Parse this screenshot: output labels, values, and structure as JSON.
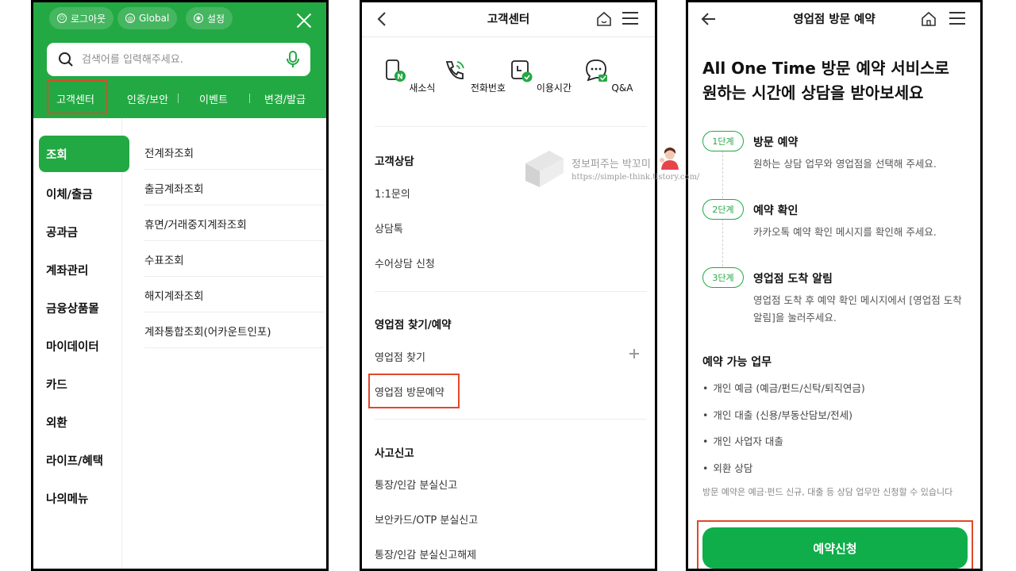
{
  "panel1": {
    "logout": "로그아웃",
    "global": "Global",
    "settings": "설정",
    "search_placeholder": "검색어를 입력해주세요.",
    "tabs": [
      "고객센터",
      "인증/보안",
      "이벤트",
      "변경/발급"
    ],
    "categories": [
      "조회",
      "이체/출금",
      "공과금",
      "계좌관리",
      "금융상품몰",
      "마이데이터",
      "카드",
      "외환",
      "라이프/혜택",
      "나의메뉴"
    ],
    "subitems": [
      "전계좌조회",
      "출금계좌조회",
      "휴면/거래중지계좌조회",
      "수표조회",
      "해지계좌조회",
      "계좌통합조회(어카운트인포)"
    ],
    "accent": "#23a943"
  },
  "panel2": {
    "title": "고객센터",
    "quick": [
      "새소식",
      "전화번호",
      "이용시간",
      "Q&A"
    ],
    "sections": [
      {
        "title": "고객상담",
        "items": [
          "1:1문의",
          "상담톡",
          "수어상담 신청"
        ]
      },
      {
        "title": "영업점 찾기/예약",
        "items": [
          "영업점 찾기",
          "영업점 방문예약"
        ]
      },
      {
        "title": "사고신고",
        "items": [
          "통장/인감 분실신고",
          "보안카드/OTP 분실신고",
          "통장/인감 분실신고해제"
        ]
      }
    ]
  },
  "panel3": {
    "title": "영업점 방문 예약",
    "headline_1": "All One Time 방문 예약 서비스로",
    "headline_2": "원하는 시간에 상담을 받아보세요",
    "steps": [
      {
        "badge": "1단계",
        "title": "방문 예약",
        "desc": "원하는 상담 업무와 영업점을 선택해 주세요."
      },
      {
        "badge": "2단계",
        "title": "예약 확인",
        "desc": "카카오톡 예약 확인 메시지를 확인해 주세요."
      },
      {
        "badge": "3단계",
        "title": "영업점 도착 알림",
        "desc": "영업점 도착 후 예약 확인 메시지에서 [영업점 도착 알림]을 눌러주세요."
      }
    ],
    "available_title": "예약 가능 업무",
    "available": [
      "개인 예금 (예금/펀드/신탁/퇴직연금)",
      "개인 대출 (신용/부동산담보/전세)",
      "개인 사업자 대출",
      "외환 상담"
    ],
    "note": "방문 예약은 예금·펀드 신규, 대출 등 상담 업무만 신청할 수 있습니다",
    "button": "예약신청"
  },
  "watermark": {
    "line1": "정보퍼주는 박꼬미",
    "line2": "https://simple-think.tistory.com/"
  },
  "highlight_color": "#e2482a"
}
